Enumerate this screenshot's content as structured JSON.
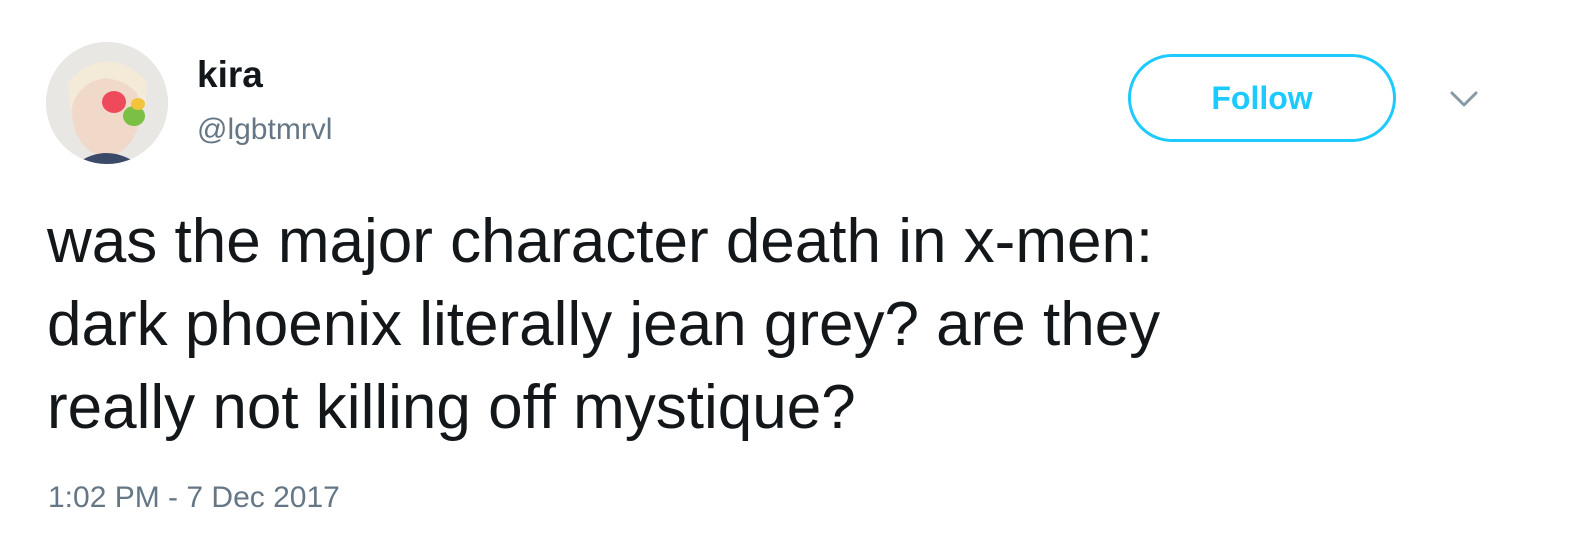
{
  "author": {
    "display_name": "kira",
    "handle": "@lgbtmrvl"
  },
  "actions": {
    "follow_label": "Follow",
    "menu_icon": "chevron-down-icon"
  },
  "tweet": {
    "lines": [
      "was the major character death in x-men:",
      "dark phoenix literally jean grey? are they",
      "really not killing off mystique?"
    ],
    "timestamp": "1:02 PM - 7 Dec 2017"
  },
  "colors": {
    "accent": "#1dcaff",
    "text": "#14171a",
    "secondary": "#657786"
  }
}
